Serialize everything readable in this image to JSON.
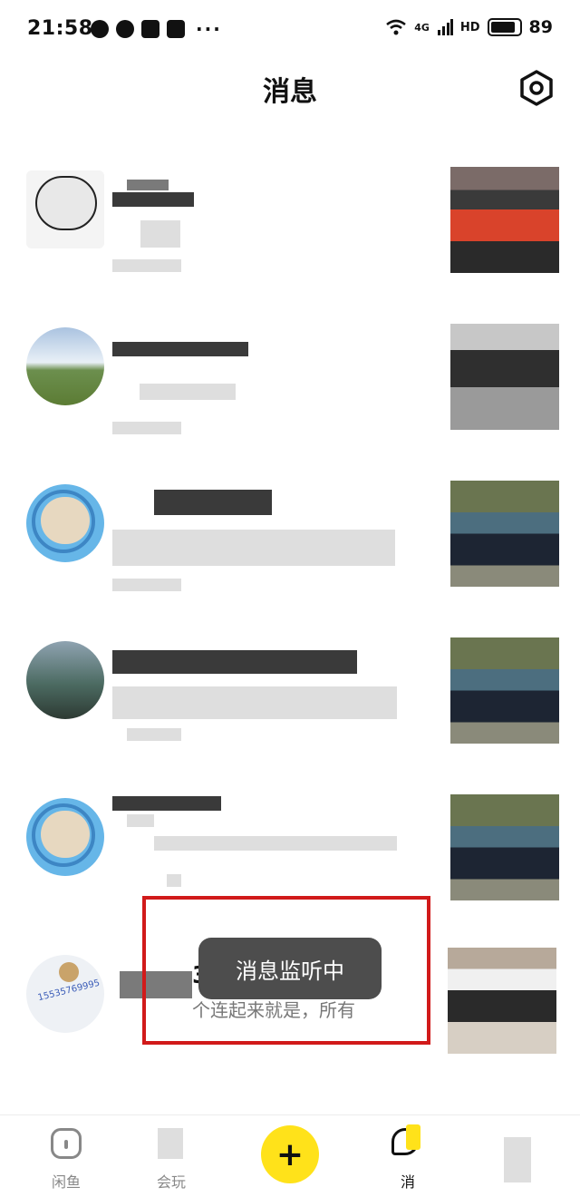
{
  "status_bar": {
    "time": "21:58",
    "dots": "···",
    "network": "4G",
    "hd": "HD",
    "battery": "89"
  },
  "header": {
    "title": "消息",
    "settings_icon": "gear-hexagon-icon"
  },
  "messages": [
    {
      "name": "",
      "snippet": "",
      "avatar": "meme-face",
      "thumbnail": "blurred"
    },
    {
      "name": "",
      "snippet": "",
      "avatar": "landscape",
      "thumbnail": "blurred"
    },
    {
      "name": "",
      "snippet": "",
      "avatar": "astronaut-cat",
      "thumbnail": "blurred"
    },
    {
      "name": "",
      "snippet": "",
      "avatar": "green-car",
      "thumbnail": "blurred"
    },
    {
      "name": "",
      "snippet": "",
      "avatar": "astronaut-cat",
      "thumbnail": "blurred"
    },
    {
      "name": "355",
      "snippet": "个连起来就是，所有",
      "avatar": "tape-roll",
      "avatar_text": "15535769995",
      "thumbnail": "blurred"
    }
  ],
  "toast": {
    "text": "消息监听中"
  },
  "highlight_color": "#d11a1a",
  "bottom_nav": {
    "items": [
      {
        "label": "闲鱼",
        "icon": "fish-home-icon"
      },
      {
        "label": "会玩",
        "icon": "play-icon"
      },
      {
        "label": "+",
        "icon": "plus-icon"
      },
      {
        "label": "消",
        "icon": "message-icon"
      },
      {
        "label": "",
        "icon": "profile-icon"
      }
    ],
    "accent": "#ffe21a"
  }
}
